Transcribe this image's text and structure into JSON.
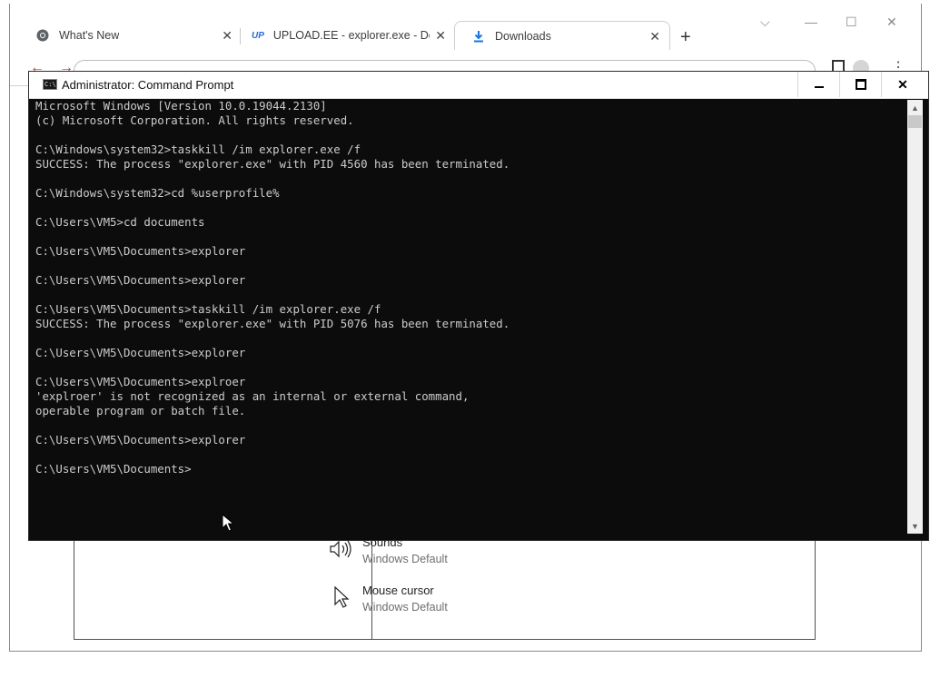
{
  "browser": {
    "tabs": [
      {
        "title": "What's New",
        "icon": "chrome-icon",
        "active": false
      },
      {
        "title": "UPLOAD.EE - explorer.exe - Dow",
        "icon": "upload-ee-icon",
        "icon_text": "UP",
        "active": false
      },
      {
        "title": "Downloads",
        "icon": "download-icon",
        "active": true
      }
    ],
    "new_tab_label": "+",
    "settings": [
      {
        "title": "Sounds",
        "subtitle": "Windows Default",
        "icon": "speaker-icon"
      },
      {
        "title": "Mouse cursor",
        "subtitle": "Windows Default",
        "icon": "mouse-cursor-icon"
      }
    ]
  },
  "cmd": {
    "title": "Administrator: Command Prompt",
    "lines": [
      "Microsoft Windows [Version 10.0.19044.2130]",
      "(c) Microsoft Corporation. All rights reserved.",
      "",
      "C:\\Windows\\system32>taskkill /im explorer.exe /f",
      "SUCCESS: The process \"explorer.exe\" with PID 4560 has been terminated.",
      "",
      "C:\\Windows\\system32>cd %userprofile%",
      "",
      "C:\\Users\\VM5>cd documents",
      "",
      "C:\\Users\\VM5\\Documents>explorer",
      "",
      "C:\\Users\\VM5\\Documents>explorer",
      "",
      "C:\\Users\\VM5\\Documents>taskkill /im explorer.exe /f",
      "SUCCESS: The process \"explorer.exe\" with PID 5076 has been terminated.",
      "",
      "C:\\Users\\VM5\\Documents>explorer",
      "",
      "C:\\Users\\VM5\\Documents>explroer",
      "'explroer' is not recognized as an internal or external command,",
      "operable program or batch file.",
      "",
      "C:\\Users\\VM5\\Documents>explorer",
      "",
      "C:\\Users\\VM5\\Documents>"
    ],
    "colors": {
      "background": "#0c0c0c",
      "text": "#cccccc"
    }
  }
}
